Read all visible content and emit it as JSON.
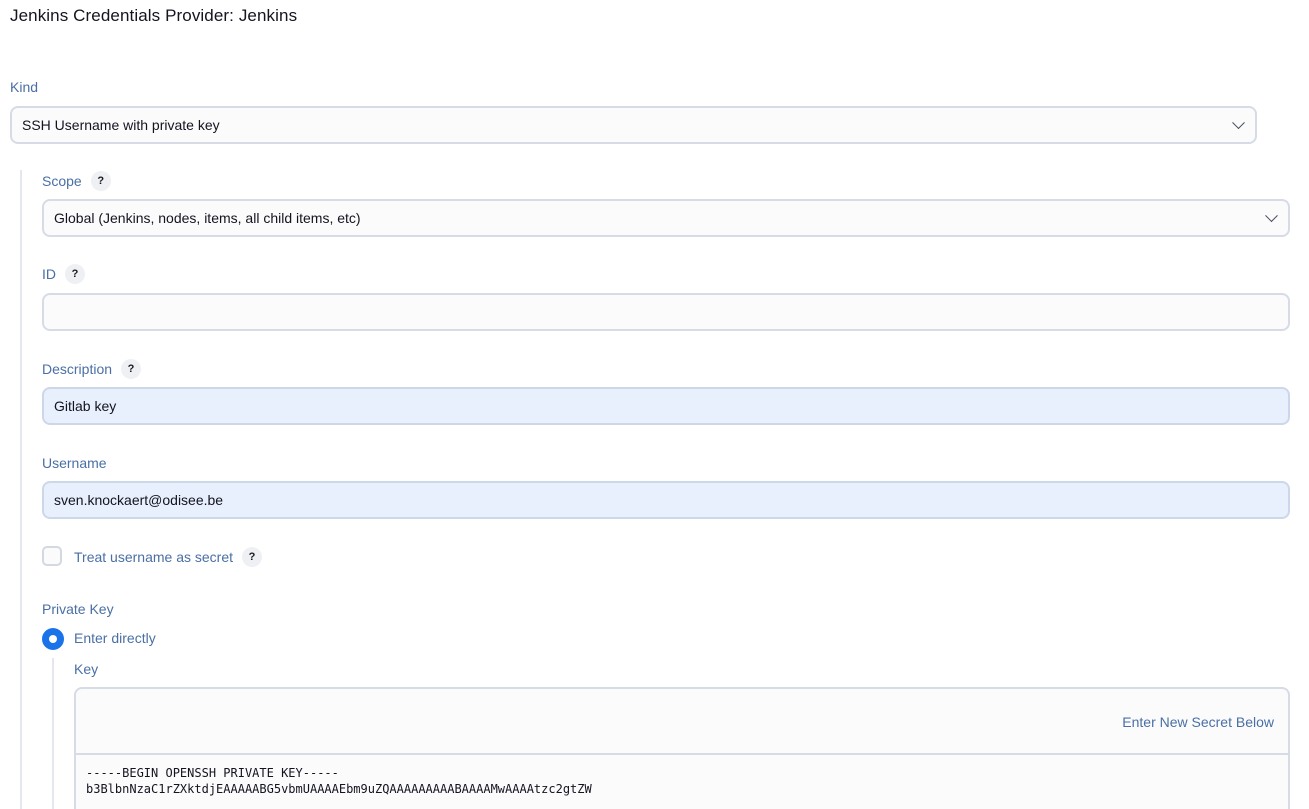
{
  "page": {
    "title": "Jenkins Credentials Provider: Jenkins"
  },
  "kind": {
    "label": "Kind",
    "value": "SSH Username with private key"
  },
  "scope": {
    "label": "Scope",
    "help": "?",
    "value": "Global (Jenkins, nodes, items, all child items, etc)"
  },
  "id_field": {
    "label": "ID",
    "help": "?",
    "value": ""
  },
  "description": {
    "label": "Description",
    "help": "?",
    "value": "Gitlab key"
  },
  "username": {
    "label": "Username",
    "value": "sven.knockaert@odisee.be"
  },
  "treat_secret": {
    "label": "Treat username as secret",
    "help": "?",
    "checked": false
  },
  "private_key": {
    "label": "Private Key",
    "option_label": "Enter directly",
    "selected": true,
    "key_label": "Key",
    "secret_link": "Enter New Secret Below",
    "key_lines": [
      "-----BEGIN OPENSSH PRIVATE KEY-----",
      "b3BlbnNzaC1rZXktdjEAAAAABG5vbmUAAAAEbm9uZQAAAAAAAAABAAAAMwAAAAtzc2gtZW"
    ]
  },
  "colors": {
    "label_blue": "#4a6fa5",
    "radio_blue": "#1a73e8",
    "filled_input_bg": "#e8f0fd"
  },
  "icons": {
    "dropdown": "chevron-down-icon",
    "help": "help-icon"
  }
}
